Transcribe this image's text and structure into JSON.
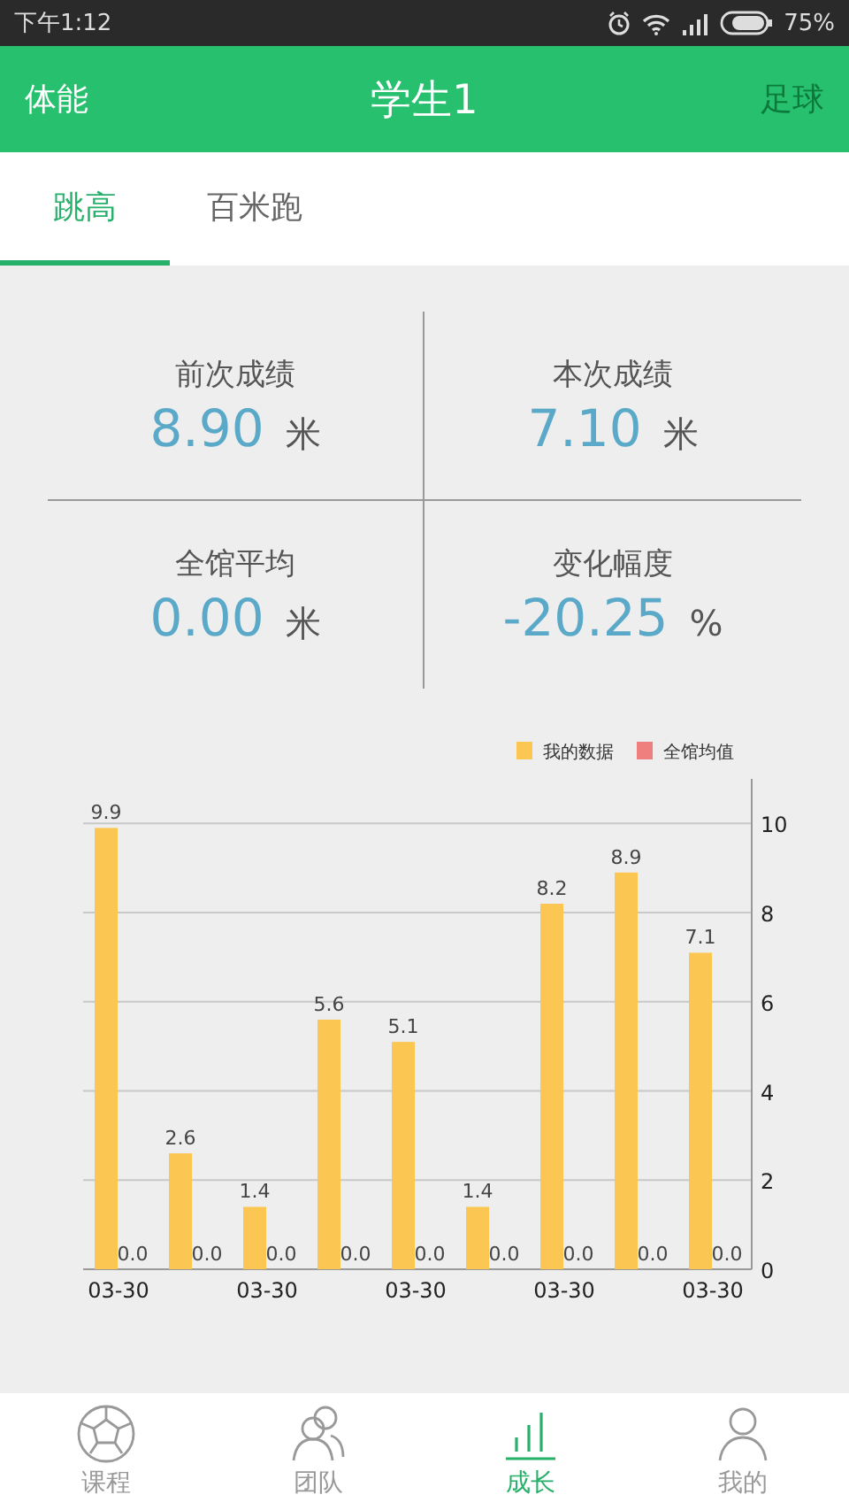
{
  "status_bar": {
    "time": "下午1:12",
    "battery": "75%"
  },
  "header": {
    "left": "体能",
    "title": "学生1",
    "right": "足球"
  },
  "tabs": [
    {
      "label": "跳高",
      "selected": true
    },
    {
      "label": "百米跑",
      "selected": false
    }
  ],
  "stats": [
    {
      "label": "前次成绩",
      "value": "8.90",
      "unit": "米"
    },
    {
      "label": "本次成绩",
      "value": "7.10",
      "unit": "米"
    },
    {
      "label": "全馆平均",
      "value": "0.00",
      "unit": "米"
    },
    {
      "label": "变化幅度",
      "value": "-20.25",
      "unit": "%"
    }
  ],
  "chart_data": {
    "type": "bar",
    "ylim": [
      0,
      11
    ],
    "yticks": [
      0,
      2,
      4,
      6,
      8,
      10
    ],
    "grid": true,
    "categories": [
      "03-30",
      null,
      "03-30",
      null,
      "03-30",
      null,
      "03-30",
      null,
      "03-30"
    ],
    "series": [
      {
        "name": "我的数据",
        "color": "#fbc652",
        "values": [
          9.9,
          2.6,
          1.4,
          5.6,
          5.1,
          1.4,
          8.2,
          8.9,
          7.1
        ],
        "value_labels": [
          "9.9",
          "2.6",
          "1.4",
          "5.6",
          "5.1",
          "1.4",
          "8.2",
          "8.9",
          "7.1"
        ]
      },
      {
        "name": "全馆均值",
        "color": "#ef7f7f",
        "values": [
          0,
          0,
          0,
          0,
          0,
          0,
          0,
          0,
          0
        ],
        "value_labels": [
          "0.0",
          "0.0",
          "0.0",
          "0.0",
          "0.0",
          "0.0",
          "0.0",
          "0.0",
          "0.0"
        ]
      }
    ]
  },
  "nav": [
    {
      "label": "课程",
      "kind": "ball",
      "selected": false
    },
    {
      "label": "团队",
      "kind": "people",
      "selected": false
    },
    {
      "label": "成长",
      "kind": "growth",
      "selected": true
    },
    {
      "label": "我的",
      "kind": "person",
      "selected": false
    }
  ]
}
